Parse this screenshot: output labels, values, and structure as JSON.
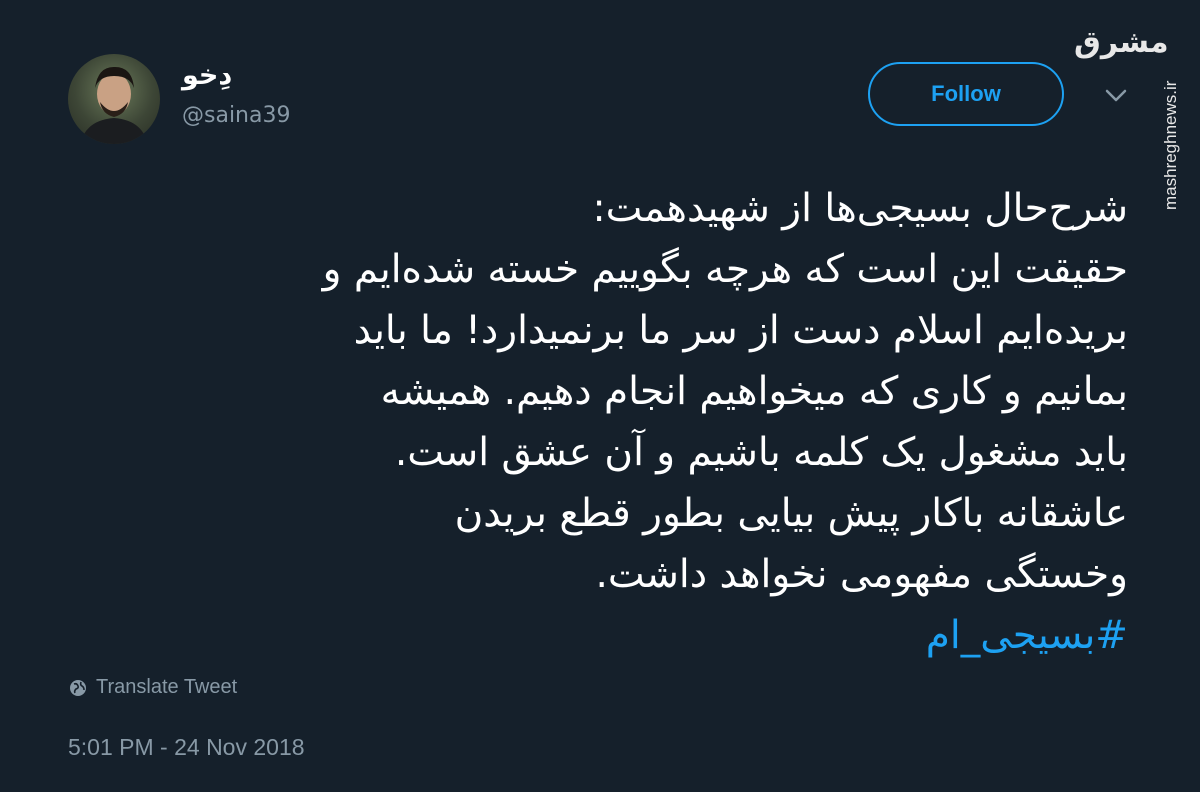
{
  "user": {
    "display_name": "دِخو",
    "handle": "@saina39"
  },
  "follow_label": "Follow",
  "watermark": {
    "logo_text": "مشرق",
    "url": "mashreghnews.ir"
  },
  "tweet": {
    "lines": [
      "شرح‌حال بسیجی‌ها از شهیدهمت:",
      "حقیقت این است که هرچه بگوییم خسته شده‌ایم و",
      "بریده‌ایم اسلام دست از سر ما برنمیدارد! ما باید",
      "بمانیم و کاری که میخواهیم انجام دهیم. همیشه",
      "باید مشغول یک کلمه باشیم و آن عشق است.",
      "عاشقانه باکار پیش بیایی بطور قطع بریدن",
      "وخستگی مفهومی نخواهد داشت."
    ],
    "hashtag": "#بسیجی_ام"
  },
  "translate_label": "Translate Tweet",
  "timestamp": "5:01 PM - 24 Nov 2018",
  "colors": {
    "background": "#15202b",
    "accent": "#1da1f2",
    "secondary_text": "#8899a6"
  }
}
